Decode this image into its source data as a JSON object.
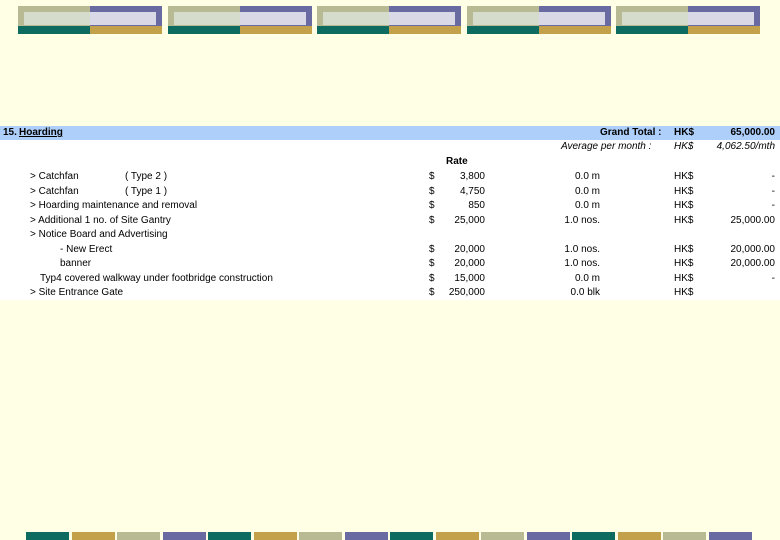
{
  "section": {
    "number": "15.",
    "title": "Hoarding",
    "grand_total_label": "Grand Total :",
    "grand_total_currency": "HK$",
    "grand_total_value": "65,000.00",
    "avg_label": "Average per month :",
    "avg_currency": "HK$",
    "avg_value": "4,062.50/mth",
    "rate_header": "Rate"
  },
  "rows": [
    {
      "desc": "> Catchfan",
      "type": "( Type 2 )",
      "sym": "$",
      "rate": "3,800",
      "qty": "0.0 m",
      "cur": "HK$",
      "amount": "-"
    },
    {
      "desc": "> Catchfan",
      "type": "( Type 1 )",
      "sym": "$",
      "rate": "4,750",
      "qty": "0.0 m",
      "cur": "HK$",
      "amount": "-"
    },
    {
      "desc": "> Hoarding maintenance and removal",
      "type": "",
      "sym": "$",
      "rate": "850",
      "qty": "0.0 m",
      "cur": "HK$",
      "amount": "-"
    },
    {
      "desc": "> Additional 1 no. of Site Gantry",
      "type": "",
      "sym": "$",
      "rate": "25,000",
      "qty": "1.0 nos.",
      "cur": "HK$",
      "amount": "25,000.00"
    },
    {
      "desc": "> Notice Board and Advertising",
      "type": "",
      "sym": "",
      "rate": "",
      "qty": "",
      "cur": "",
      "amount": ""
    },
    {
      "desc": "- New Erect",
      "type": "",
      "sym": "$",
      "rate": "20,000",
      "qty": "1.0 nos.",
      "cur": "HK$",
      "amount": "20,000.00"
    },
    {
      "desc": "banner",
      "type": "",
      "sym": "$",
      "rate": "20,000",
      "qty": "1.0 nos.",
      "cur": "HK$",
      "amount": "20,000.00"
    },
    {
      "desc": "Typ4 covered walkway under footbridge construction",
      "type": "",
      "sym": "$",
      "rate": "15,000",
      "qty": "0.0 m",
      "cur": "HK$",
      "amount": "-"
    },
    {
      "desc": "> Site Entrance Gate",
      "type": "",
      "sym": "$",
      "rate": "250,000",
      "qty": "0.0 blk",
      "cur": "HK$",
      "amount": ""
    }
  ],
  "colors": {
    "page_bg": "#ffffe6",
    "header_band": "#aecffa",
    "tile_olive": "#b8ba93",
    "tile_purple": "#6a6aa2",
    "tile_teal": "#0d6b5f",
    "tile_gold": "#c3a04a"
  }
}
